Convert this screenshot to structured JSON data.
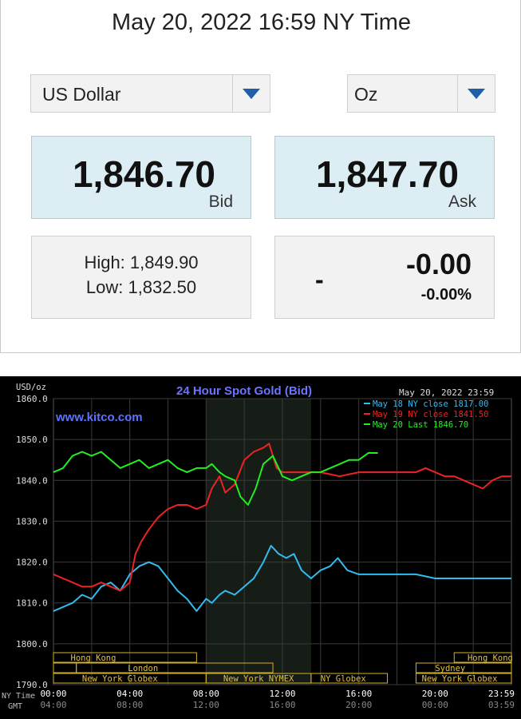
{
  "header": {
    "timestamp": "May 20, 2022 16:59 NY Time"
  },
  "currency_select": {
    "value": "US Dollar"
  },
  "unit_select": {
    "value": "Oz"
  },
  "bid": {
    "value": "1,846.70",
    "label": "Bid"
  },
  "ask": {
    "value": "1,847.70",
    "label": "Ask"
  },
  "range": {
    "high": "High: 1,849.90",
    "low": "Low: 1,832.50"
  },
  "change": {
    "dash": "-",
    "value": "-0.00",
    "percent": "-0.00%"
  },
  "colors": {
    "price_bg": "#dceef4",
    "arrow": "#1f5fa8",
    "chart_bg": "#000000"
  },
  "chart_data": {
    "type": "line",
    "title": "24 Hour Spot Gold (Bid)",
    "unit_label": "USD/oz",
    "watermark": "www.kitco.com",
    "date_label": "May 20, 2022 23:59",
    "ylim": [
      1790,
      1860
    ],
    "y_ticks": [
      "1860.0",
      "1850.0",
      "1840.0",
      "1830.0",
      "1820.0",
      "1810.0",
      "1800.0",
      "1790.0"
    ],
    "x_row_labels": {
      "ny": "NY Time",
      "gmt": "GMT"
    },
    "x_ticks_ny": [
      "00:00",
      "04:00",
      "08:00",
      "12:00",
      "16:00",
      "20:00",
      "23:59"
    ],
    "x_ticks_gmt": [
      "04:00",
      "08:00",
      "12:00",
      "16:00",
      "20:00",
      "00:00",
      "03:59"
    ],
    "grid": true,
    "legend_position": "top-right",
    "sessions": [
      "Hong Kong",
      "London",
      "New York Globex",
      "New York NYMEX",
      "NY Globex",
      "Sydney",
      "Hong Kong",
      "New York Globex"
    ],
    "series": [
      {
        "name": "May 18 NY close 1817.00",
        "color": "#33bbee",
        "x": [
          0,
          0.5,
          1,
          1.5,
          2,
          2.5,
          3,
          3.5,
          4,
          4.5,
          5,
          5.5,
          6,
          6.5,
          7,
          7.5,
          8,
          8.3,
          8.7,
          9,
          9.5,
          10,
          10.5,
          11,
          11.4,
          11.8,
          12.2,
          12.6,
          13,
          13.5,
          14,
          14.5,
          14.9,
          15.4,
          16,
          17,
          18,
          19,
          20,
          21,
          22,
          23,
          23.99
        ],
        "y": [
          1808,
          1809,
          1810,
          1812,
          1811,
          1814,
          1815,
          1813,
          1817,
          1819,
          1820,
          1819,
          1816,
          1813,
          1811,
          1808,
          1811,
          1810,
          1812,
          1813,
          1812,
          1814,
          1816,
          1820,
          1824,
          1822,
          1821,
          1822,
          1818,
          1816,
          1818,
          1819,
          1821,
          1818,
          1817,
          1817,
          1817,
          1817,
          1816,
          1816,
          1816,
          1816,
          1816
        ]
      },
      {
        "name": "May 19 NY close 1841.50",
        "color": "#ee2222",
        "x": [
          0,
          0.5,
          1,
          1.5,
          2,
          2.5,
          3,
          3.5,
          4,
          4.3,
          4.6,
          5,
          5.5,
          6,
          6.5,
          7,
          7.5,
          8,
          8.3,
          8.7,
          9,
          9.5,
          10,
          10.5,
          11,
          11.3,
          11.7,
          12,
          12.5,
          13,
          14,
          15,
          16,
          17,
          18,
          19,
          19.5,
          20,
          20.5,
          21,
          21.5,
          22,
          22.5,
          23,
          23.5,
          23.99
        ],
        "y": [
          1817,
          1816,
          1815,
          1814,
          1814,
          1815,
          1814,
          1813,
          1815,
          1822,
          1825,
          1828,
          1831,
          1833,
          1834,
          1834,
          1833,
          1834,
          1838,
          1841,
          1837,
          1839,
          1845,
          1847,
          1848,
          1849,
          1843,
          1842,
          1842,
          1842,
          1842,
          1841,
          1842,
          1842,
          1842,
          1842,
          1843,
          1842,
          1841,
          1841,
          1840,
          1839,
          1838,
          1840,
          1841,
          1841
        ]
      },
      {
        "name": "May 20 Last 1846.70",
        "color": "#22ee22",
        "x": [
          0,
          0.5,
          1,
          1.5,
          2,
          2.5,
          3,
          3.5,
          4,
          4.5,
          5,
          5.5,
          6,
          6.5,
          7,
          7.5,
          8,
          8.3,
          8.7,
          9,
          9.5,
          9.8,
          10.2,
          10.6,
          11,
          11.5,
          12,
          12.5,
          13,
          13.5,
          14,
          14.5,
          15,
          15.5,
          16,
          16.5,
          17
        ],
        "y": [
          1842,
          1843,
          1846,
          1847,
          1846,
          1847,
          1845,
          1843,
          1844,
          1845,
          1843,
          1844,
          1845,
          1843,
          1842,
          1843,
          1843,
          1844,
          1842,
          1841,
          1840,
          1836,
          1834,
          1838,
          1844,
          1846,
          1841,
          1840,
          1841,
          1842,
          1842,
          1843,
          1844,
          1845,
          1845,
          1846.7,
          1846.7
        ]
      }
    ]
  }
}
